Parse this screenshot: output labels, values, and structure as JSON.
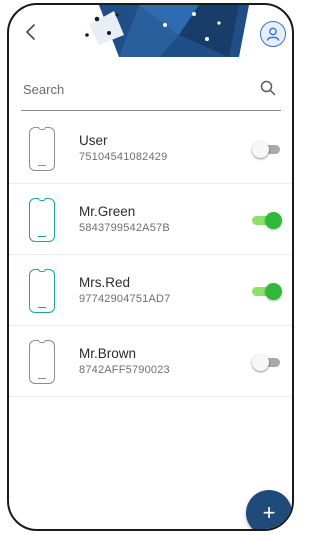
{
  "header": {
    "back_icon": "chevron-left-icon",
    "profile_icon": "user-icon"
  },
  "search": {
    "placeholder": "Search",
    "value": "",
    "icon": "search-icon"
  },
  "devices": [
    {
      "name": "User",
      "id": "75104541082429",
      "enabled": false
    },
    {
      "name": "Mr.Green",
      "id": "5843799542A57B",
      "enabled": true
    },
    {
      "name": "Mrs.Red",
      "id": "97742904751AD7",
      "enabled": true
    },
    {
      "name": "Mr.Brown",
      "id": "8742AFF5790023",
      "enabled": false
    }
  ],
  "fab": {
    "label": "+"
  },
  "colors": {
    "accent_navy": "#1e4b7a",
    "toggle_on": "#2fb83a",
    "device_active": "#1aa79a",
    "device_inactive": "#8d8d8d"
  }
}
